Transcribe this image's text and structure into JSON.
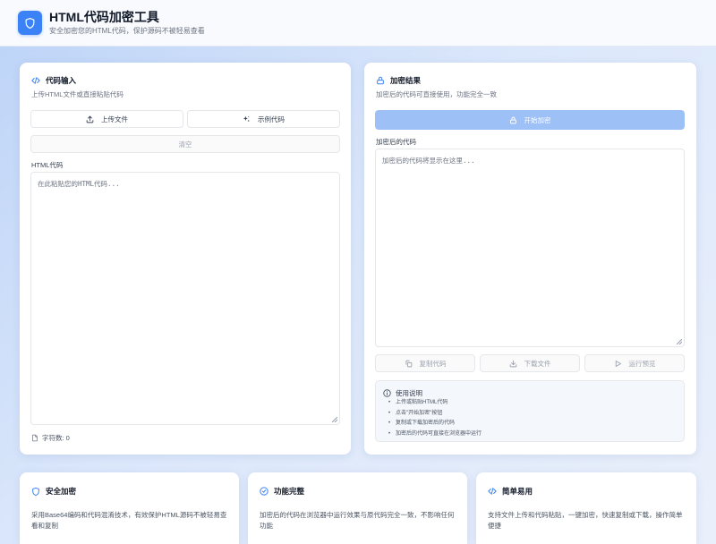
{
  "header": {
    "title": "HTML代码加密工具",
    "subtitle": "安全加密您的HTML代码，保护源码不被轻易查看"
  },
  "input_panel": {
    "title": "代码输入",
    "description": "上传HTML文件或直接粘贴代码",
    "upload_label": "上传文件",
    "example_label": "示例代码",
    "clear_label": "清空",
    "field_label": "HTML代码",
    "placeholder": "在此粘贴您的HTML代码...",
    "char_count_label": "字符数: 0"
  },
  "output_panel": {
    "title": "加密结果",
    "description": "加密后的代码可直接使用，功能完全一致",
    "encrypt_label": "开始加密",
    "field_label": "加密后的代码",
    "placeholder": "加密后的代码将显示在这里...",
    "copy_label": "复制代码",
    "download_label": "下载文件",
    "preview_label": "运行预览",
    "usage": {
      "title": "使用说明",
      "items": [
        "上传或粘贴HTML代码",
        "点击\"开始加密\"按钮",
        "复制或下载加密后的代码",
        "加密后的代码可直接在浏览器中运行"
      ]
    }
  },
  "features": [
    {
      "title": "安全加密",
      "description": "采用Base64编码和代码混淆技术，有效保护HTML源码不被轻易查看和复制"
    },
    {
      "title": "功能完整",
      "description": "加密后的代码在浏览器中运行效果与原代码完全一致，不影响任何功能"
    },
    {
      "title": "简单易用",
      "description": "支持文件上传和代码粘贴，一键加密，快速复制或下载，操作简单便捷"
    }
  ],
  "colors": {
    "accent": "#3b82f6",
    "primary_disabled": "#9dc0f7"
  },
  "icons": {
    "logo": "shield-icon",
    "input_title": "code-icon",
    "output_title": "lock-icon"
  }
}
